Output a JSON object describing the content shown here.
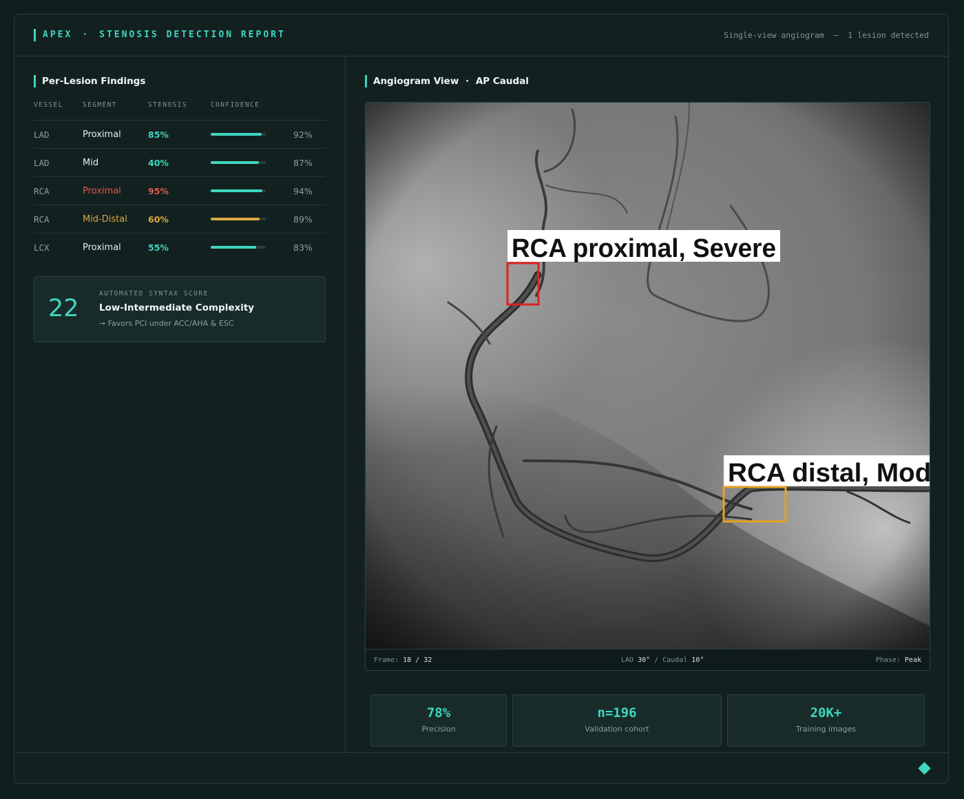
{
  "header": {
    "brand": "APEX",
    "separator": "·",
    "title": "STENOSIS DETECTION REPORT",
    "meta": "Single-view angiogram  —  1 lesion detected"
  },
  "findings": {
    "title": "Per-Lesion Findings",
    "columns": [
      "VESSEL",
      "SEGMENT",
      "STENOSIS",
      "CONFIDENCE"
    ],
    "rows": [
      {
        "vessel": "LAD",
        "segment": "Proximal",
        "stenosis": "85%",
        "confidence": 0.92,
        "confidence_label": "92%",
        "status": "normal"
      },
      {
        "vessel": "LAD",
        "segment": "Mid",
        "stenosis": "40%",
        "confidence": 0.87,
        "confidence_label": "87%",
        "status": "normal"
      },
      {
        "vessel": "RCA",
        "segment": "Proximal",
        "stenosis": "95%",
        "confidence": 0.94,
        "confidence_label": "94%",
        "status": "severe"
      },
      {
        "vessel": "RCA",
        "segment": "Mid-Distal",
        "stenosis": "60%",
        "confidence": 0.89,
        "confidence_label": "89%",
        "status": "moderate"
      },
      {
        "vessel": "LCX",
        "segment": "Proximal",
        "stenosis": "55%",
        "confidence": 0.83,
        "confidence_label": "83%",
        "status": "normal"
      }
    ]
  },
  "syntax": {
    "score": "22",
    "caption": "AUTOMATED SYNTAX SCORE",
    "title": "Low-Intermediate Complexity",
    "subtitle": "→ Favors PCI under ACC/AHA & ESC"
  },
  "viewer": {
    "title_main": "Angiogram View",
    "title_sep": "·",
    "title_view": "AP Caudal",
    "annotations": [
      {
        "label": "RCA proximal, Severe",
        "color": "#e02020"
      },
      {
        "label": "RCA distal, Moderate",
        "color": "#e8a020"
      }
    ],
    "frame_label": "Frame:",
    "frame_value": "18 / 32",
    "angle_lao_label": "LAO",
    "angle_lao_value": "30°",
    "angle_sep": "/",
    "angle_caudal_label": "Caudal",
    "angle_caudal_value": "10°",
    "phase_label": "Phase:",
    "phase_value": "Peak"
  },
  "stats": [
    {
      "value": "78%",
      "label": "Precision"
    },
    {
      "value": "n=196",
      "label": "Validation cohort"
    },
    {
      "value": "20K+",
      "label": "Training images"
    }
  ],
  "colors": {
    "accent": "#3fd6c0",
    "severe": "#e05a4a",
    "moderate": "#d8a840",
    "normal_text": "#e6efed"
  }
}
